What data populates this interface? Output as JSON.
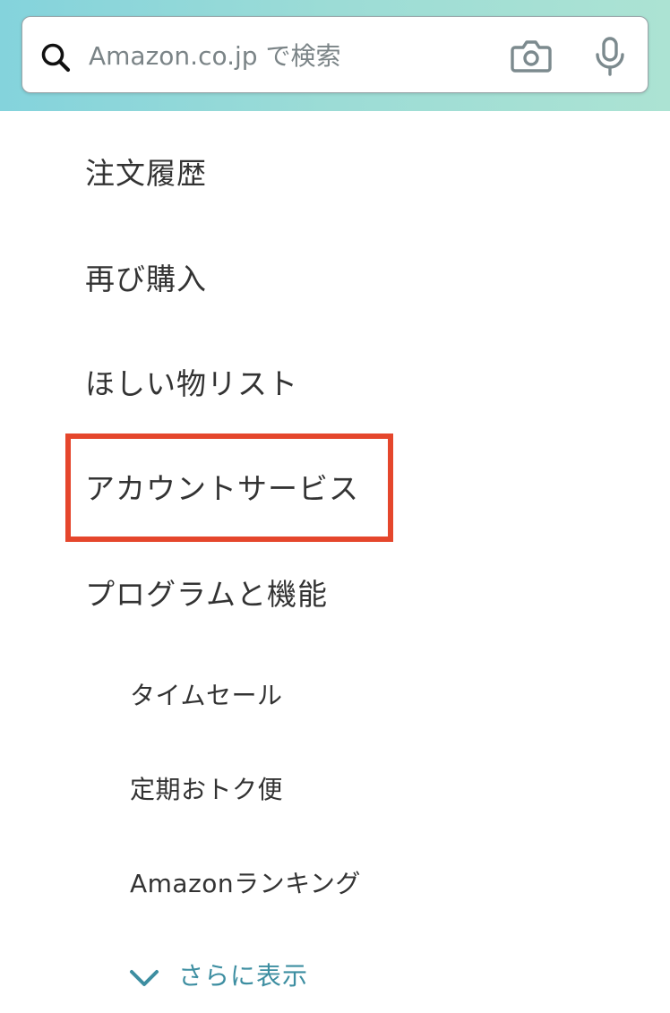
{
  "search": {
    "placeholder": "Amazon.co.jp で検索"
  },
  "icons": {
    "search": "search-icon",
    "camera": "camera-icon",
    "microphone": "microphone-icon",
    "chevron": "chevron-down-icon"
  },
  "menu": {
    "order_history": "注文履歴",
    "buy_again": "再び購入",
    "wish_list": "ほしい物リスト",
    "account_services": "アカウントサービス",
    "programs_features": "プログラムと機能"
  },
  "programs": {
    "items": [
      "タイムセール",
      "定期おトク便",
      "Amazonランキング"
    ],
    "show_more": "さらに表示"
  },
  "colors": {
    "header_gradient_start": "#84d3dc",
    "header_gradient_end": "#ace3d3",
    "highlight": "#e5462c",
    "link": "#3d8ea1",
    "text": "#333333"
  }
}
